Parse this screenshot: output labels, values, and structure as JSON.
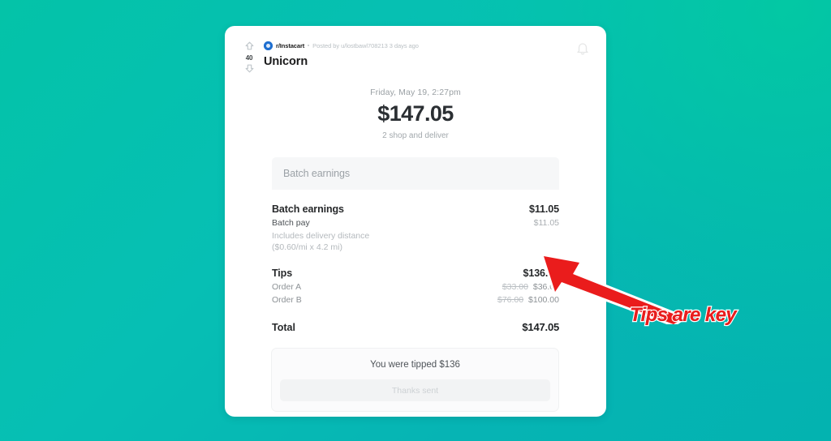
{
  "background": {
    "color_start": "#04c3a8",
    "color_end": "#03b3b0"
  },
  "post": {
    "vote_count": "40",
    "upvote_icon": "upvote-arrow-icon",
    "downvote_icon": "downvote-arrow-icon",
    "subreddit": "r/Instacart",
    "meta": "Posted by u/lostbawl708213 3 days ago",
    "title": "Unicorn",
    "bell_icon": "bell-icon"
  },
  "receipt": {
    "date": "Friday, May 19, 2:27pm",
    "amount": "$147.05",
    "subtitle": "2 shop and deliver",
    "section_tab_label": "Batch earnings",
    "batch": {
      "header_label": "Batch earnings",
      "header_value": "$11.05",
      "pay_label": "Batch pay",
      "pay_value": "$11.05",
      "note_line_1": "Includes delivery distance",
      "note_line_2": "($0.60/mi x 4.2 mi)"
    },
    "tips": {
      "header_label": "Tips",
      "header_value": "$136.00",
      "orders": [
        {
          "label": "Order A",
          "old_value": "$33.00",
          "new_value": "$36.00"
        },
        {
          "label": "Order B",
          "old_value": "$76.00",
          "new_value": "$100.00"
        }
      ]
    },
    "total": {
      "label": "Total",
      "value": "$147.05"
    },
    "tip_card": {
      "message": "You were tipped $136",
      "button_label": "Thanks sent"
    }
  },
  "annotation": {
    "text": "Tips are key",
    "color": "#e81e1e",
    "arrow_icon": "arrow-pointing-up-left-icon"
  }
}
